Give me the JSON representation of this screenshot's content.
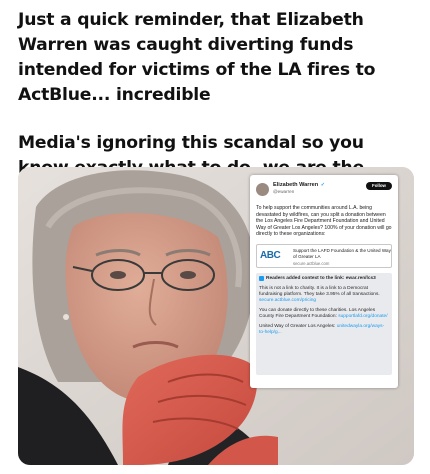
{
  "post": {
    "line1": "Just a quick reminder, that Elizabeth Warren was caught diverting funds intended for victims of the LA fires to ActBlue... incredible",
    "line2": "Media's ignoring this scandal so you know exactly what to do, we are the media now"
  },
  "image": {
    "alt": "Photo of a woman with shoulder-length gray hair and glasses, hands clasped at her chin"
  },
  "embedded_tweet": {
    "name": "Elizabeth Warren",
    "verified_mark": "✓",
    "handle": "@ewarren",
    "follow_label": "Follow",
    "body": "To help support the communities around L.A. being devastated by wildfires, can you split a donation between the Los Angeles Fire Department Foundation and United Way of Greater Los Angeles? 100% of your donation will go directly to these organizations:",
    "link_card": {
      "logo_text": "ABC",
      "title": "Support the LAFD Foundation & the United Way of Greater LA",
      "domain": "secure.actblue.com"
    },
    "community_note": {
      "heading": "Readers added context to the link: ewar.ren/lcs3",
      "p1": "This is not a link to charity. It is a link to a Democrat fundraising platform. They take 3.95% of all transactions.",
      "p1_link": "secure.actblue.com/pricing",
      "p2": "You can donate directly to these charities. Los Angeles County Fire Department Foundation:",
      "p2_link": "supportlafd.org/donate/",
      "p3": "United Way of Greater Los Angeles:",
      "p3_link": "unitedwayla.org/ways-to-help/g..."
    }
  },
  "colors": {
    "accent": "#1d9bf0",
    "text": "#111111"
  }
}
